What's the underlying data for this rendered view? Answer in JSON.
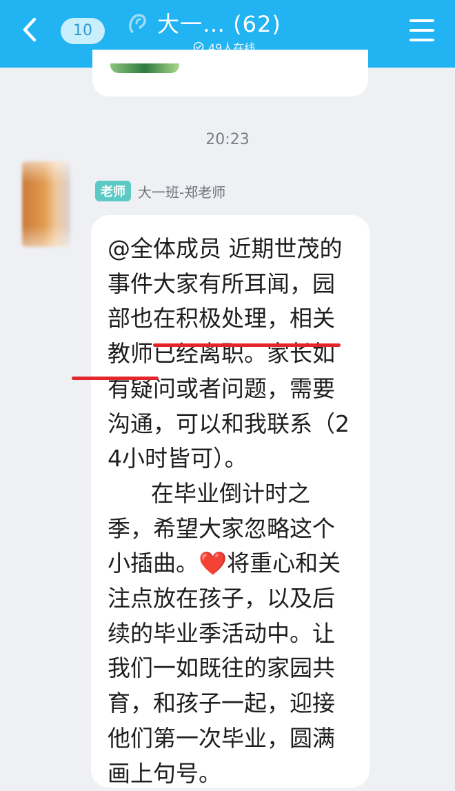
{
  "header": {
    "unread_count": "10",
    "title": "大一… (62)",
    "online_status": "49人在线",
    "icons": {
      "back": "chevron-left-icon",
      "audio": "ear-icon",
      "online": "online-status-icon",
      "menu": "hamburger-menu-icon"
    }
  },
  "chat": {
    "timestamp": "20:23",
    "message": {
      "role_badge": "老师",
      "sender": "大一班-郑老师",
      "text_before_emoji": "@全体成员 近期世茂的事件大家有所耳闻，园部也在积极处理，相关教师已经离职。家长如有疑问或者问题，需要沟通，可以和我联系（24小时皆可）。\n      在毕业倒计时之季，希望大家忽略这个小插曲。",
      "emoji": "❤️",
      "text_after_emoji": "将重心和关注点放在孩子，以及后续的毕业季活动中。让我们一如既往的家园共育，和孩子一起，迎接他们第一次毕业，圆满画上句号。",
      "highlighted_phrase": "相关教师已经离职"
    }
  },
  "colors": {
    "header_bg": "#22b4f2",
    "chat_bg": "#eef0f4",
    "bubble_bg": "#ffffff",
    "badge_bg": "#5cc9c4",
    "underline": "#e2262b"
  }
}
